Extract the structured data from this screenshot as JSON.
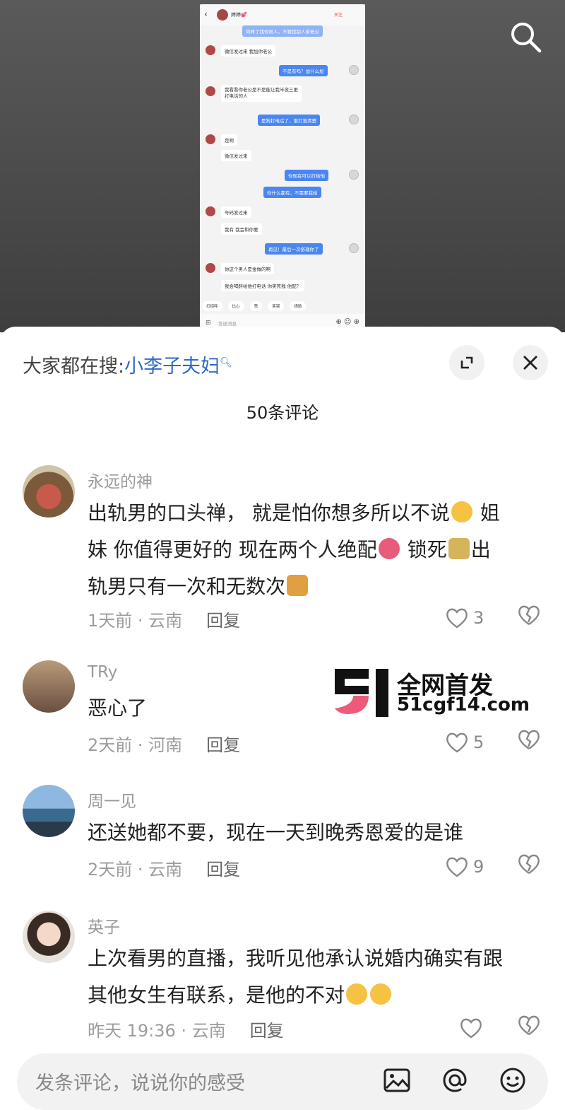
{
  "screenshot": {
    "header_search_icon": "search-icon",
    "header_bubble_labels": {
      "top_partial": "同样了找你男人，不要找别人家老公"
    },
    "chat": {
      "contact_name": "婷婷💕",
      "follow_label": "关注",
      "messages": [
        {
          "side": "left",
          "text": "微信发过来 我加你老公"
        },
        {
          "side": "right",
          "text": "不是有吗？加什么加"
        },
        {
          "side": "left",
          "text": "我看看你老公是不是能让我半夜三更"
        },
        {
          "side": "left",
          "text": "打电话的人"
        },
        {
          "side": "right",
          "text": "是狗打电话了，谁打谁清楚"
        },
        {
          "side": "left",
          "text": "是啊"
        },
        {
          "side": "left",
          "text": "微信发过来"
        },
        {
          "side": "right",
          "text": "你现在可以打给他"
        },
        {
          "side": "right",
          "text": "你什么都有，不需要我给"
        },
        {
          "side": "left",
          "text": "号码发过来"
        },
        {
          "side": "left",
          "text": "我有 我会和你要"
        },
        {
          "side": "right",
          "text": "再见！最后一次搭理你了"
        },
        {
          "side": "left",
          "text": "你这个男人是金做的啊"
        },
        {
          "side": "left",
          "text": "我会喝醉给他打电话 你笑死我 他配？"
        }
      ],
      "quick_replies": [
        "打招呼",
        "比心",
        "赞",
        "笑哭",
        "捂脸"
      ],
      "input_placeholder": "发送消息"
    }
  },
  "sheet": {
    "hot_label": "大家都在搜:",
    "hot_keyword": "小李子夫妇",
    "comment_count": "50条评论",
    "expand_icon": "expand-icon",
    "close_icon": "close-icon"
  },
  "comments": [
    {
      "name": "永远的神",
      "line1": "出轨男的口头禅， 就是怕你想多所以不说",
      "line1b": " 姐",
      "line2": "妹 你值得更好的 现在两个人绝配",
      "line2b": " 锁死",
      "line2c": "出",
      "line3": "轨男只有一次和无数次",
      "time": "1天前 · 云南",
      "reply": "回复",
      "likes": "3"
    },
    {
      "name": "TRy",
      "text": "恶心了",
      "time": "2天前 · 河南",
      "reply": "回复",
      "likes": "5"
    },
    {
      "name": "周一见",
      "text": "还送她都不要，现在一天到晚秀恩爱的是谁",
      "time": "2天前 · 云南",
      "reply": "回复",
      "likes": "9"
    },
    {
      "name": "英子",
      "line1": "上次看男的直播，我听见他承认说婚内确实有跟",
      "line2": "其他女生有联系，是他的不对",
      "time": "昨天 19:36 · 云南",
      "reply": "回复",
      "likes": ""
    }
  ],
  "watermark": {
    "line1": "全网首发",
    "line2": "51cgf14.com"
  },
  "input_bar": {
    "placeholder": "发条评论，说说你的感受",
    "icons": [
      "image-icon",
      "at-icon",
      "emoji-icon"
    ]
  },
  "colors": {
    "link": "#2f6ac2",
    "meta": "#9c9c9c",
    "chat_blue": "#4a86f0"
  }
}
